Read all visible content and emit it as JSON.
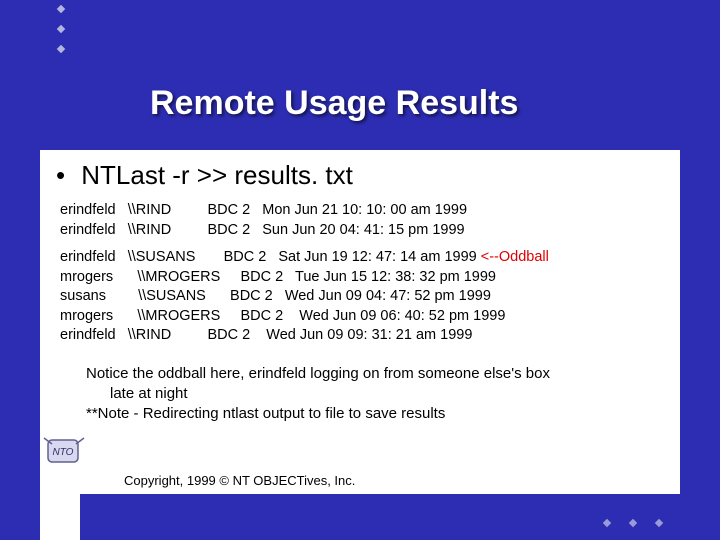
{
  "title": "Remote Usage Results",
  "command_bullet": "•",
  "command": "NTLast -r >> results. txt",
  "rows_group1": [
    {
      "user": "erindfeld",
      "host": "\\\\RIND",
      "bdc": "BDC 2",
      "ts": "Mon Jun 21 10: 10: 00 am 1999"
    },
    {
      "user": "erindfeld",
      "host": "\\\\RIND",
      "bdc": "BDC 2",
      "ts": "Sun Jun 20 04: 41: 15 pm 1999"
    }
  ],
  "rows_group2": [
    {
      "user": "erindfeld",
      "host": "\\\\SUSANS",
      "bdc": "BDC 2",
      "ts": "Sat Jun 19 12: 47: 14 am 1999",
      "flag": "<--Oddball"
    },
    {
      "user": "mrogers",
      "host": " \\\\MROGERS",
      "bdc": "BDC 2",
      "ts": "Tue Jun 15 12: 38: 32 pm 1999"
    },
    {
      "user": "susans",
      "host": "  \\\\SUSANS",
      "bdc": " BDC 2",
      "ts": " Wed Jun 09 04: 47: 52 pm 1999"
    },
    {
      "user": "mrogers",
      "host": " \\\\MROGERS",
      "bdc": "BDC 2",
      "ts": " Wed Jun 09 06: 40: 52 pm 1999"
    },
    {
      "user": "erindfeld",
      "host": "\\\\RIND",
      "bdc": "BDC 2",
      "ts": " Wed Jun 09 09: 31: 21 am 1999"
    }
  ],
  "note_line1": "Notice the oddball here, erindfeld logging on from someone else's box",
  "note_line2": "late at night",
  "note_line3": "**Note - Redirecting ntlast output to file to save results",
  "copyright": "Copyright, 1999 © NT OBJECTives, Inc.",
  "logo_text": "NTO"
}
